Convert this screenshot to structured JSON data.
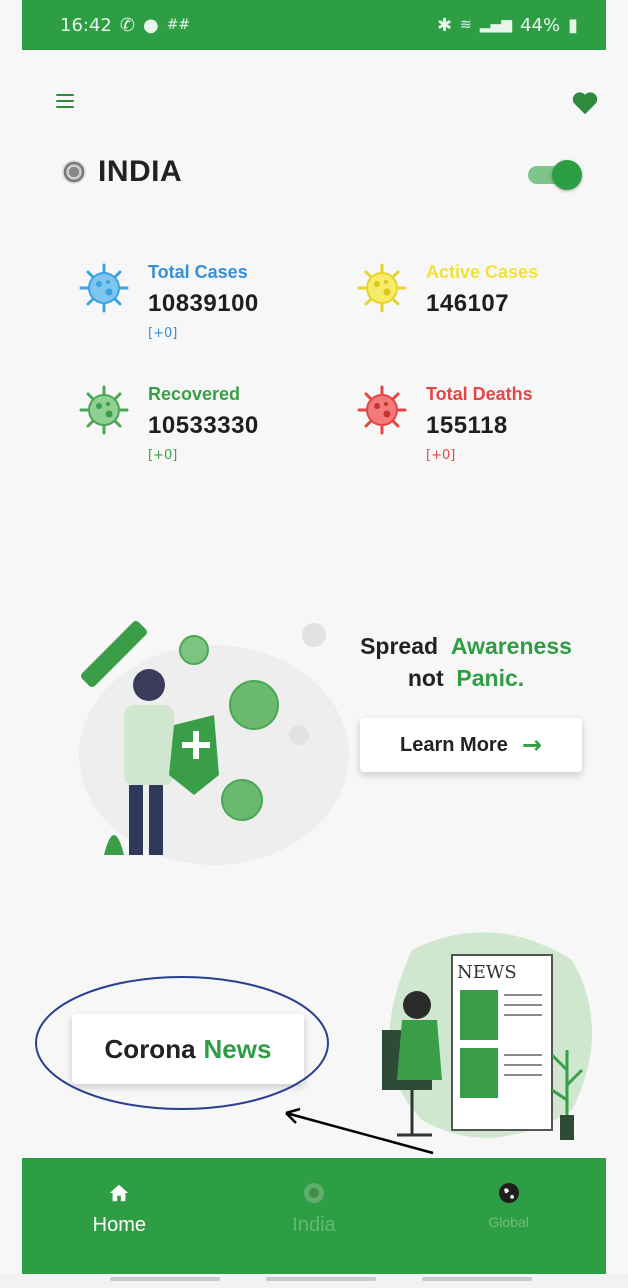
{
  "status_bar": {
    "time": "16:42",
    "left_icons": [
      "call-icon",
      "whatsapp-icon",
      "hash-icon"
    ],
    "right_text": "44%",
    "right_icons": [
      "bluetooth-icon",
      "wifi-icon",
      "signal-icon",
      "battery-icon"
    ]
  },
  "header": {
    "country": "INDIA",
    "menu_icon": "hamburger-menu-icon",
    "favorite_icon": "heart-icon",
    "toggle_on": true
  },
  "stats": [
    {
      "label": "Total Cases",
      "value": "10839100",
      "delta": "[+0]",
      "color": "#3a8ed8",
      "delta_color": "#3a8ed8",
      "icon": "virus-icon"
    },
    {
      "label": "Active Cases",
      "value": "146107",
      "delta": "",
      "color": "#f1e13a",
      "delta_color": "#e6d42a",
      "icon": "virus-icon"
    },
    {
      "label": "Recovered",
      "value": "10533330",
      "delta": "[+0]",
      "color": "#3a9e48",
      "delta_color": "#3a9e48",
      "icon": "virus-icon"
    },
    {
      "label": "Total Deaths",
      "value": "155118",
      "delta": "[+0]",
      "color": "#e64545",
      "delta_color": "#e64545",
      "icon": "virus-icon"
    }
  ],
  "awareness": {
    "line1_a": "Spread",
    "line1_b": "Awareness",
    "line2_a": "not",
    "line2_b": "Panic.",
    "button_label": "Learn More"
  },
  "news": {
    "label_a": "Corona",
    "label_b": "News",
    "newspaper_text": "NEWS"
  },
  "bottom_nav": [
    {
      "label": "Home",
      "icon": "home-icon",
      "active": true
    },
    {
      "label": "India",
      "icon": "india-flag-icon",
      "active": false
    },
    {
      "label": "Global",
      "icon": "globe-icon",
      "active": false
    }
  ],
  "colors": {
    "primary": "#2e9e45",
    "accent_light": "#7fc48b",
    "text": "#222222",
    "annotation": "#2b3f8f"
  }
}
